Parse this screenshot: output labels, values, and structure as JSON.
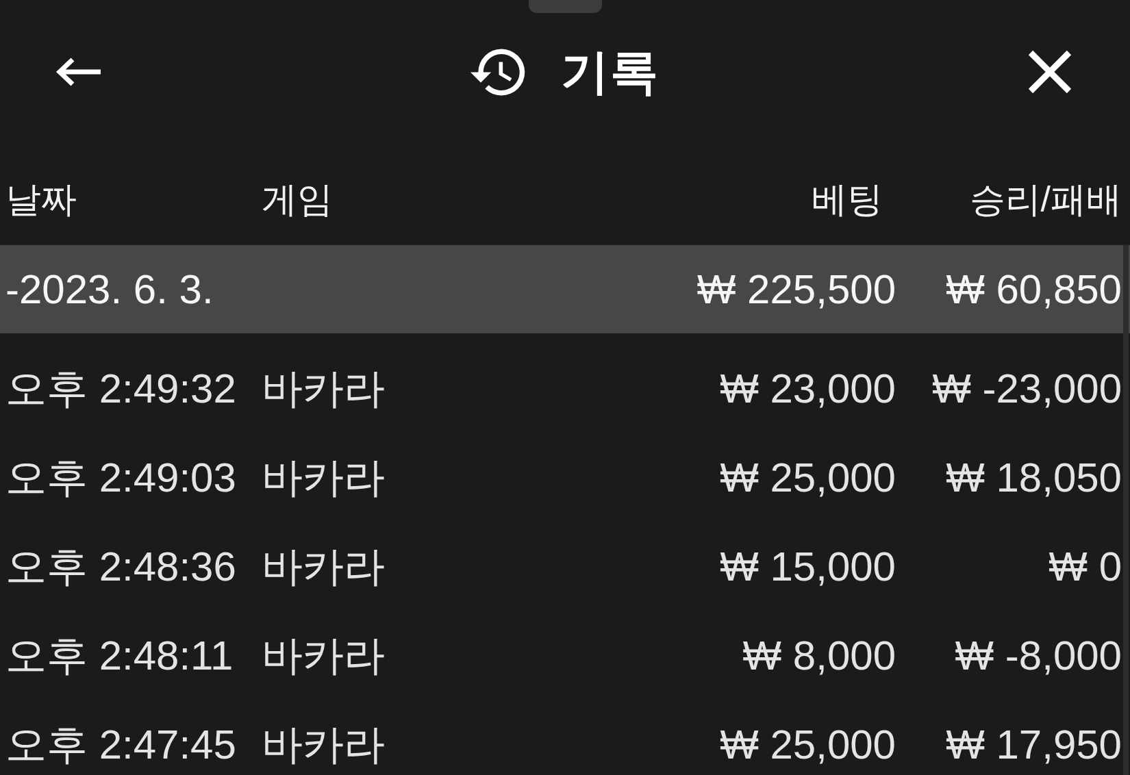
{
  "header": {
    "title": "기록"
  },
  "table": {
    "columns": [
      "날짜",
      "게임",
      "베팅",
      "승리/패배"
    ],
    "rows": [
      {
        "kind": "date-group",
        "date": "-2023. 6. 3.",
        "bet": "₩ 225,500",
        "result": "₩ 60,850"
      },
      {
        "kind": "entry",
        "time": "오후 2:49:32",
        "game": "바카라",
        "bet": "₩ 23,000",
        "result": "₩ -23,000"
      },
      {
        "kind": "entry",
        "time": "오후 2:49:03",
        "game": "바카라",
        "bet": "₩ 25,000",
        "result": "₩ 18,050"
      },
      {
        "kind": "entry",
        "time": "오후 2:48:36",
        "game": "바카라",
        "bet": "₩ 15,000",
        "result": "₩ 0"
      },
      {
        "kind": "entry",
        "time": "오후 2:48:11",
        "game": "바카라",
        "bet": "₩ 8,000",
        "result": "₩ -8,000"
      },
      {
        "kind": "entry",
        "time": "오후 2:47:45",
        "game": "바카라",
        "bet": "₩ 25,000",
        "result": "₩ 17,950"
      }
    ]
  }
}
